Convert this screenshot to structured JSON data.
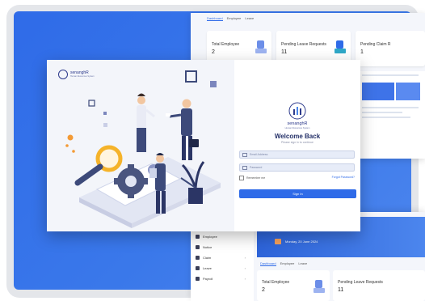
{
  "background_dashboard_top": {
    "tabs": [
      "Dashboard",
      "Employee",
      "Leave"
    ],
    "stats": [
      {
        "label": "Total Employee",
        "value": "2"
      },
      {
        "label": "Pending Leave Requests",
        "value": "11"
      },
      {
        "label": "Pending Claim R",
        "value": "1"
      }
    ]
  },
  "background_dashboard_bottom": {
    "nav_items": [
      "Employee",
      "Notice",
      "Claim",
      "Leave",
      "Payroll"
    ],
    "banner_date": "Monday, 20 June 2024",
    "tabs": [
      "Dashboard",
      "Employee",
      "Leave"
    ],
    "stats": [
      {
        "label": "Total Employee",
        "value": "2"
      },
      {
        "label": "Pending Leave Requests",
        "value": "11"
      }
    ]
  },
  "login": {
    "brand_name": "senanghR",
    "brand_tagline": "Human Resources System",
    "title": "Welcome Back",
    "subtitle": "Please sign in to continue",
    "email_placeholder": "Email Address",
    "password_placeholder": "Password",
    "remember_label": "Remember me",
    "forgot_label": "Forgot Password?",
    "signin_label": "Sign In"
  },
  "colors": {
    "accent": "#2f6be8",
    "brand_navy": "#243068",
    "page_bg": "#e4e6ea"
  }
}
